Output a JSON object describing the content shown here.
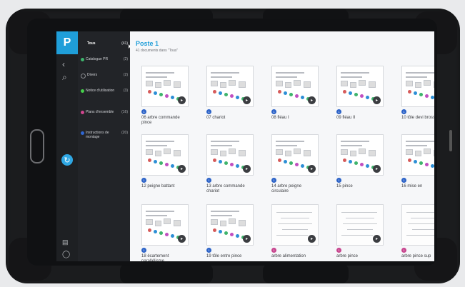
{
  "sidebar": {
    "logo": "P",
    "icons": [
      "chevron-left-icon",
      "search-icon",
      "sync-icon",
      "id-card-icon",
      "user-icon"
    ]
  },
  "nav": {
    "items": [
      {
        "label": "Tous",
        "count": "(41)",
        "color": "",
        "active": true
      },
      {
        "label": "Catalogue PR",
        "count": "(2)",
        "color": "#3eb46c",
        "active": false
      },
      {
        "label": "Divers",
        "count": "(2)",
        "color": "#222428",
        "active": false
      },
      {
        "label": "Notice d'utilisation",
        "count": "(3)",
        "color": "#46d04c",
        "active": false
      },
      {
        "label": "Plans d'ensemble",
        "count": "(16)",
        "color": "#d0468f",
        "active": false
      },
      {
        "label": "Instructions de montage",
        "count": "(20)",
        "color": "#2f66d1",
        "active": false
      }
    ]
  },
  "main": {
    "title": "Poste 1",
    "subtitle": "41 documents dans \"Tous\"",
    "documents": [
      {
        "title": "06 arbre commande pince",
        "badge": "1",
        "badge_color": "blue"
      },
      {
        "title": "07 chariot",
        "badge": "1",
        "badge_color": "blue"
      },
      {
        "title": "08 fléau I",
        "badge": "1",
        "badge_color": "blue"
      },
      {
        "title": "09 fléau II",
        "badge": "1",
        "badge_color": "blue"
      },
      {
        "title": "10 tôle devi brosse",
        "badge": "1",
        "badge_color": "blue"
      },
      {
        "title": "12 peigne battant",
        "badge": "1",
        "badge_color": "blue"
      },
      {
        "title": "13 arbre commande chariot",
        "badge": "1",
        "badge_color": "blue"
      },
      {
        "title": "14 arbre peigne circulaire",
        "badge": "1",
        "badge_color": "blue"
      },
      {
        "title": "15 pince",
        "badge": "1",
        "badge_color": "blue"
      },
      {
        "title": "16 mise en",
        "badge": "1",
        "badge_color": "blue"
      },
      {
        "title": "18 écartement parallélisme",
        "badge": "1",
        "badge_color": "blue"
      },
      {
        "title": "19 tôle entre pince",
        "badge": "1",
        "badge_color": "blue"
      },
      {
        "title": "arbre alimentation",
        "badge": "1",
        "badge_color": "pink"
      },
      {
        "title": "arbre pince",
        "badge": "1",
        "badge_color": "pink"
      },
      {
        "title": "arbre pince sup",
        "badge": "1",
        "badge_color": "pink"
      }
    ]
  }
}
